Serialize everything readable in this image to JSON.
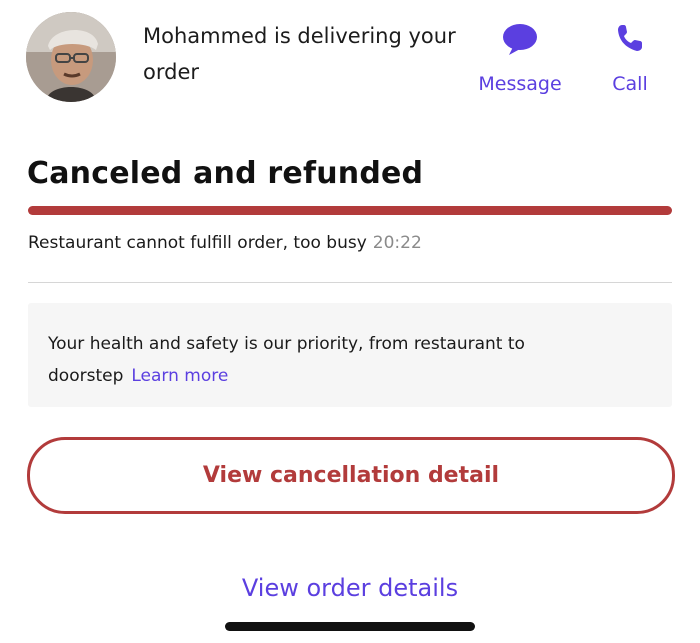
{
  "driver": {
    "avatar_icon": "driver-avatar",
    "status_text": "Mohammed is delivering your order"
  },
  "actions": {
    "message": {
      "label": "Message",
      "icon": "chat-bubble-icon"
    },
    "call": {
      "label": "Call",
      "icon": "phone-icon"
    }
  },
  "status": {
    "title": "Canceled and refunded",
    "reason": "Restaurant cannot fulfill order, too busy",
    "time": "20:22",
    "bar_color": "#b23b3b",
    "progress": 1.0
  },
  "safety": {
    "text": "Your health and safety is our priority, from restaurant to doorstep",
    "link": "Learn more"
  },
  "buttons": {
    "cancellation_detail": "View cancellation detail",
    "order_details": "View order details"
  },
  "colors": {
    "accent": "#5b3fe0",
    "danger": "#b23b3b"
  }
}
